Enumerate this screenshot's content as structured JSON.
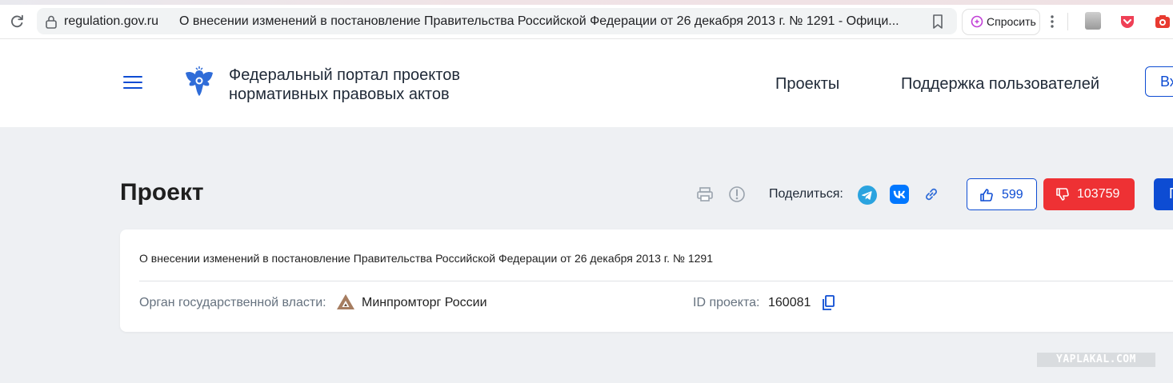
{
  "browser": {
    "domain": "regulation.gov.ru",
    "tab_title": "О внесении изменений в постановление Правительства Российской Федерации от 26 декабря 2013 г. № 1291 - Офици...",
    "ask_label": "Спросить"
  },
  "header": {
    "portal_name_line1": "Федеральный портал проектов",
    "portal_name_line2": "нормативных правовых актов",
    "nav": {
      "projects": "Проекты",
      "support": "Поддержка пользователей"
    },
    "login_label": "Вх"
  },
  "project": {
    "page_title": "Проект",
    "share_label": "Поделиться:",
    "likes": "599",
    "dislikes": "103759",
    "blue_button_label": "П",
    "title": "О внесении изменений в постановление Правительства Российской Федерации от 26 декабря 2013 г. № 1291",
    "authority_label": "Орган государственной власти:",
    "authority_value": "Минпромторг России",
    "id_label": "ID проекта:",
    "id_value": "160081"
  },
  "watermark": "YAPLAKAL.COM",
  "colors": {
    "accent": "#0d4cd3",
    "danger": "#ee3134",
    "background": "#eef0f3"
  }
}
